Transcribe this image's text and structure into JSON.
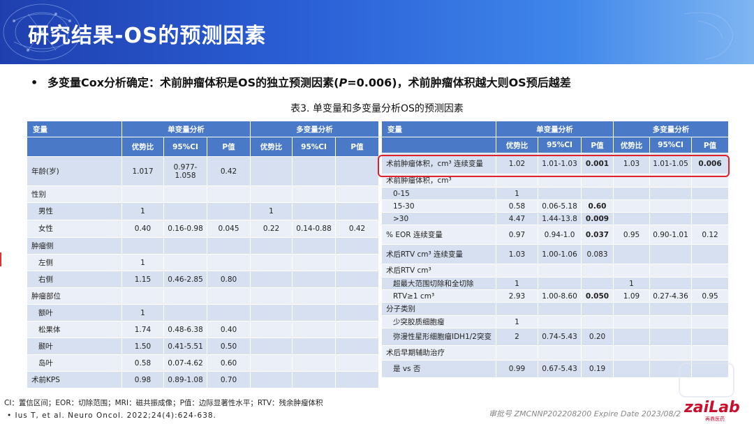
{
  "slide": {
    "title": "研究结果-OS的预测因素",
    "bullet_pre": "多变量Cox分析确定：术前肿瘤体积是OS的独立预测因素(",
    "bullet_p": "P",
    "bullet_post": "=0.006)，术前肿瘤体积越大则OS预后越差",
    "table_caption": "表3. 单变量和多变量分析OS的预测因素",
    "footnote": "CI：置信区间；EOR：切除范围；MRI：磁共振成像；P值：边际显著性水平；RTV：残余肿瘤体积",
    "reference": "Ius T, et al. Neuro Oncol. 2022;24(4):624-638.",
    "approval": "审批号 ZMCNNP202208200 Expire Date 2023/08/2",
    "logo_text": "zaiLab",
    "logo_sub": "再鼎医药",
    "accent_color": "#4a7ac7",
    "highlight_color": "#e0202a"
  },
  "headers": {
    "variable": "变量",
    "univariate": "单变量分析",
    "multivariate": "多变量分析",
    "hr": "优势比",
    "ci": "95%CI",
    "p": "P值"
  },
  "left_rows": [
    {
      "label": "年龄(岁)",
      "indent": false,
      "uhr": "1.017",
      "uci": "0.977-\n1.058",
      "up": "0.42",
      "mhr": "",
      "mci": "",
      "mp": ""
    },
    {
      "label": "性别",
      "indent": false,
      "uhr": "",
      "uci": "",
      "up": "",
      "mhr": "",
      "mci": "",
      "mp": ""
    },
    {
      "label": "男性",
      "indent": true,
      "uhr": "1",
      "uci": "",
      "up": "",
      "mhr": "1",
      "mci": "",
      "mp": ""
    },
    {
      "label": "女性",
      "indent": true,
      "uhr": "0.40",
      "uci": "0.16-0.98",
      "up": "0.045",
      "mhr": "0.22",
      "mci": "0.14-0.88",
      "mp": "0.42"
    },
    {
      "label": "肿瘤侧",
      "indent": false,
      "uhr": "",
      "uci": "",
      "up": "",
      "mhr": "",
      "mci": "",
      "mp": ""
    },
    {
      "label": "左侧",
      "indent": true,
      "uhr": "1",
      "uci": "",
      "up": "",
      "mhr": "",
      "mci": "",
      "mp": ""
    },
    {
      "label": "右侧",
      "indent": true,
      "uhr": "1.15",
      "uci": "0.46-2.85",
      "up": "0.80",
      "mhr": "",
      "mci": "",
      "mp": ""
    },
    {
      "label": "肿瘤部位",
      "indent": false,
      "uhr": "",
      "uci": "",
      "up": "",
      "mhr": "",
      "mci": "",
      "mp": ""
    },
    {
      "label": "额叶",
      "indent": true,
      "uhr": "1",
      "uci": "",
      "up": "",
      "mhr": "",
      "mci": "",
      "mp": ""
    },
    {
      "label": "松果体",
      "indent": true,
      "uhr": "1.74",
      "uci": "0.48-6.38",
      "up": "0.40",
      "mhr": "",
      "mci": "",
      "mp": ""
    },
    {
      "label": "颞叶",
      "indent": true,
      "uhr": "1.50",
      "uci": "0.41-5.51",
      "up": "0.50",
      "mhr": "",
      "mci": "",
      "mp": ""
    },
    {
      "label": "岛叶",
      "indent": true,
      "uhr": "0.58",
      "uci": "0.07-4.62",
      "up": "0.60",
      "mhr": "",
      "mci": "",
      "mp": ""
    },
    {
      "label": "术前KPS",
      "indent": false,
      "uhr": "0.98",
      "uci": "0.89-1.08",
      "up": "0.70",
      "mhr": "",
      "mci": "",
      "mp": ""
    }
  ],
  "right_rows": [
    {
      "label": "术前肿瘤体积，cm³ 连续变量",
      "indent": false,
      "uhr": "1.02",
      "uci": "1.01-1.03",
      "up": "0.001",
      "up_bold": true,
      "mhr": "1.03",
      "mci": "1.01-1.05",
      "mp": "0.006",
      "mp_bold": true
    },
    {
      "label": "术前肿瘤体积，cm³",
      "indent": false,
      "uhr": "",
      "uci": "",
      "up": "",
      "mhr": "",
      "mci": "",
      "mp": ""
    },
    {
      "label": "0-15",
      "indent": true,
      "uhr": "1",
      "uci": "",
      "up": "",
      "mhr": "",
      "mci": "",
      "mp": ""
    },
    {
      "label": "15-30",
      "indent": true,
      "uhr": "0.58",
      "uci": "0.06-5.18",
      "up": "0.60",
      "up_bold": true,
      "mhr": "",
      "mci": "",
      "mp": ""
    },
    {
      "label": ">30",
      "indent": true,
      "uhr": "4.47",
      "uci": "1.44-13.8",
      "up": "0.009",
      "up_bold": true,
      "mhr": "",
      "mci": "",
      "mp": ""
    },
    {
      "label": "% EOR 连续变量",
      "indent": false,
      "uhr": "0.97",
      "uci": "0.94-1.0",
      "up": "0.037",
      "up_bold": true,
      "mhr": "0.95",
      "mci": "0.90-1.01",
      "mp": "0.12"
    },
    {
      "label": "术后RTV cm³ 连续变量",
      "indent": false,
      "uhr": "1.03",
      "uci": "1.00-1.06",
      "up": "0.083",
      "mhr": "",
      "mci": "",
      "mp": ""
    },
    {
      "label": "术后RTV cm³",
      "indent": false,
      "uhr": "",
      "uci": "",
      "up": "",
      "mhr": "",
      "mci": "",
      "mp": ""
    },
    {
      "label": "超最大范围切除和全切除",
      "indent": true,
      "uhr": "1",
      "uci": "",
      "up": "",
      "mhr": "1",
      "mci": "",
      "mp": ""
    },
    {
      "label": "RTV≥1 cm³",
      "indent": true,
      "uhr": "2.93",
      "uci": "1.00-8.60",
      "up": "0.050",
      "up_bold": true,
      "mhr": "1.09",
      "mci": "0.27-4.36",
      "mp": "0.95"
    },
    {
      "label": "分子类别",
      "indent": false,
      "uhr": "",
      "uci": "",
      "up": "",
      "mhr": "",
      "mci": "",
      "mp": ""
    },
    {
      "label": "少突胶质细胞瘤",
      "indent": true,
      "uhr": "1",
      "uci": "",
      "up": "",
      "mhr": "",
      "mci": "",
      "mp": ""
    },
    {
      "label": "弥漫性星形细胞瘤IDH1/2突变",
      "indent": true,
      "uhr": "2",
      "uci": "0.74-5.43",
      "up": "0.20",
      "mhr": "",
      "mci": "",
      "mp": ""
    },
    {
      "label": "术后早期辅助治疗",
      "indent": false,
      "uhr": "",
      "uci": "",
      "up": "",
      "mhr": "",
      "mci": "",
      "mp": ""
    },
    {
      "label": "是 vs 否",
      "indent": true,
      "uhr": "0.99",
      "uci": "0.67-5.43",
      "up": "0.19",
      "mhr": "",
      "mci": "",
      "mp": ""
    }
  ]
}
